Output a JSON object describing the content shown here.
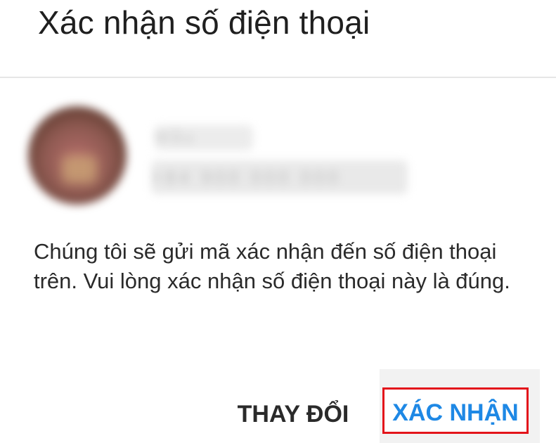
{
  "dialog": {
    "title": "Xác nhận số điện thoại",
    "account": {
      "name": "Mẫu",
      "phone": "+84 900 000 000"
    },
    "message": "Chúng tôi sẽ gửi mã xác nhận đến số điện thoại trên. Vui lòng xác nhận số điện thoại này là đúng.",
    "actions": {
      "change_label": "THAY ĐỔI",
      "confirm_label": "XÁC NHẬN"
    }
  },
  "colors": {
    "confirm_text": "#1e88e5",
    "highlight_border": "#e3141b",
    "title_text": "#1f1f1f",
    "body_text": "#2a2a2a"
  }
}
